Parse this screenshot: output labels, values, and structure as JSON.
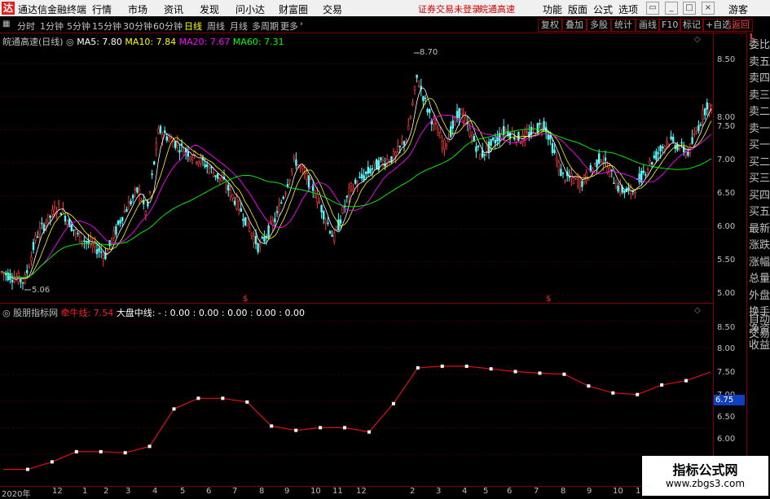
{
  "app": {
    "title": "通达信金融终端",
    "menu": [
      "行情",
      "市场",
      "资讯",
      "发现",
      "问小达",
      "财富圈",
      "交易"
    ],
    "warning": "证券交易未登录",
    "stock_short": "皖通高速",
    "tools": [
      "功能",
      "版面",
      "公式",
      "选项"
    ],
    "user": "游客"
  },
  "periods": {
    "items": [
      "分时",
      "1分钟",
      "5分钟",
      "15分钟",
      "30分钟",
      "60分钟",
      "日线",
      "周线",
      "月线",
      "多周期",
      "更多"
    ],
    "active": "日线"
  },
  "right_tools": [
    "复权",
    "叠加",
    "多股",
    "统计",
    "画线",
    "F10",
    "标记",
    "+自选",
    "返回"
  ],
  "main_legend": {
    "name": "皖通高速(日线)",
    "ma5": "MA5: 7.80",
    "ma10": "MA10: 7.84",
    "ma20": "MA20: 7.67",
    "ma60": "MA60: 7.31",
    "high_label": "8.70",
    "low_label": "5.06",
    "colors": {
      "ma5": "#ffffff",
      "ma10": "#ffff00",
      "ma20": "#ff00ff",
      "ma60": "#00ff00"
    }
  },
  "sub_legend": {
    "name": "股朋指标网",
    "line1": "牵牛线: 7.54",
    "line2": "大盘中线: - : 0.00 : 0.00 : 0.00 : 0.00 : 0.00"
  },
  "main_yticks": [
    "8.50",
    "8.00",
    "7.50",
    "7.00",
    "6.50",
    "6.00",
    "5.50",
    "5.00"
  ],
  "sub_yticks": [
    "8.50",
    "8.00",
    "7.50",
    "7.00",
    "6.50",
    "6.00"
  ],
  "sub_current": "6.75",
  "xticks": [
    "2020年",
    "12",
    "1",
    "2",
    "3",
    "4",
    "5",
    "6",
    "7",
    "8",
    "9",
    "10",
    "11",
    "12",
    "2",
    "3",
    "4",
    "5",
    "6",
    "7",
    "8",
    "9",
    "10",
    "1"
  ],
  "sidebar": [
    "委比",
    "卖五",
    "卖四",
    "卖三",
    "卖二",
    "卖一",
    "买一",
    "买二",
    "买三",
    "买四",
    "买五",
    "最新",
    "涨跌",
    "涨幅",
    "总量",
    "外盘",
    "换手",
    "净资",
    "收益",
    "自动",
    "交易"
  ],
  "watermark": {
    "line1": "指标公式网",
    "line2": "www.zbgs3.com"
  },
  "chart_data": {
    "type": "line",
    "main_ylim": [
      5.0,
      8.7
    ],
    "sub_ylim": [
      5.5,
      8.7
    ],
    "series": [
      {
        "name": "牵牛线",
        "values": [
          5.72,
          5.72,
          5.86,
          6.05,
          6.05,
          6.03,
          6.15,
          6.85,
          7.05,
          7.05,
          6.98,
          6.53,
          6.45,
          6.5,
          6.5,
          6.42,
          6.95,
          7.62,
          7.65,
          7.65,
          7.6,
          7.55,
          7.52,
          7.5,
          7.28,
          7.15,
          7.12,
          7.3,
          7.38,
          7.54
        ]
      }
    ]
  }
}
